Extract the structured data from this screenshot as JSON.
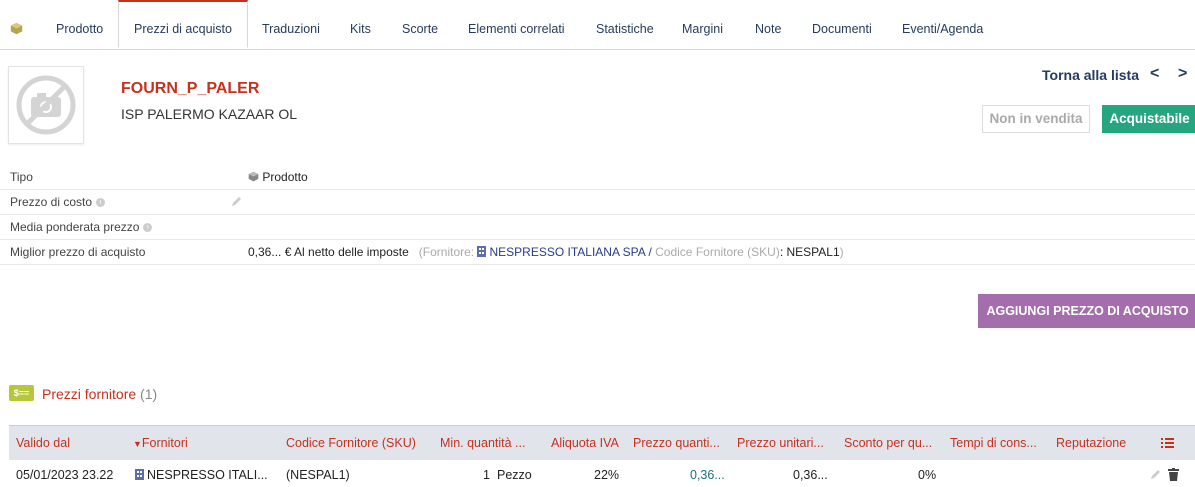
{
  "tabs": [
    {
      "label": "",
      "icon": "cube-icon"
    },
    {
      "label": "Prodotto"
    },
    {
      "label": "Prezzi di acquisto",
      "active": true
    },
    {
      "label": "Traduzioni"
    },
    {
      "label": "Kits"
    },
    {
      "label": "Scorte"
    },
    {
      "label": "Elementi correlati"
    },
    {
      "label": "Statistiche"
    },
    {
      "label": "Margini"
    },
    {
      "label": "Note"
    },
    {
      "label": "Documenti"
    },
    {
      "label": "Eventi/Agenda"
    }
  ],
  "header": {
    "ref": "FOURN_P_PALER",
    "label": "ISP PALERMO KAZAAR OL",
    "back_label": "Torna alla lista",
    "prev": "<",
    "next": ">",
    "status_sell": "Non in vendita",
    "status_buy": "Acquistabile"
  },
  "fields": {
    "tipo_label": "Tipo",
    "tipo_value": "Prodotto",
    "cost_label": "Prezzo di costo",
    "wap_label": "Media ponderata prezzo",
    "best_label": "Miglior prezzo di acquisto",
    "best_value": "0,36... € Al netto delle imposte",
    "best_open": "(Fornitore: ",
    "best_supplier": "NESPRESSO ITALIANA SPA",
    "best_sep": " / ",
    "best_sku_label": "Codice Fornitore (SKU)",
    "best_sku_value": ": NESPAL1",
    "best_close": ")"
  },
  "actions": {
    "add_price": "AGGIUNGI PREZZO DI ACQUISTO"
  },
  "section": {
    "icon_text": "$==",
    "title": "Prezzi fornitore",
    "count": "(1)"
  },
  "table": {
    "headers": [
      "Valido dal",
      "Fornitori",
      "Codice Fornitore (SKU)",
      "Min. quantità ...",
      "Aliquota IVA",
      "Prezzo quanti...",
      "Prezzo unitari...",
      "Sconto per qu...",
      "Tempi di cons...",
      "Reputazione"
    ],
    "row": {
      "date": "05/01/2023 23.22",
      "supplier": "NESPRESSO ITALI...",
      "sku": "(NESPAL1)",
      "min_qty": "1",
      "unit": "Pezzo",
      "vat": "22%",
      "price_qty": "0,36...",
      "price_unit": "0,36...",
      "discount": "0%"
    }
  },
  "colors": {
    "accent": "#c6311e",
    "navy": "#263c5c",
    "green": "#25a580",
    "purple": "#a46dac"
  }
}
